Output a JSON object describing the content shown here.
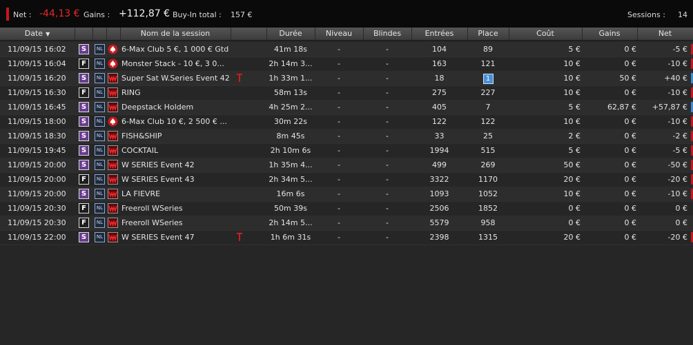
{
  "summary": {
    "net_label": "Net :",
    "net_value": "-44,13 €",
    "gains_label": "Gains :",
    "gains_value": "+112,87 €",
    "buyin_label": "Buy-In total :",
    "buyin_value": "157 €",
    "sessions_label": "Sessions :",
    "sessions_value": "14"
  },
  "columns": {
    "date": "Date",
    "name": "Nom de la session",
    "duree": "Durée",
    "niveau": "Niveau",
    "blindes": "Blindes",
    "entrees": "Entrées",
    "place": "Place",
    "cout": "Coût",
    "gains": "Gains",
    "net": "Net"
  },
  "rows": [
    {
      "date": "11/09/15 16:02",
      "type": "S",
      "limit": "NL",
      "room": "pokerstars",
      "name": "6-Max Club 5 €, 1 000 € Gtd",
      "ticket": false,
      "duree": "41m 18s",
      "niveau": "-",
      "blindes": "-",
      "entrees": "104",
      "place": "89",
      "place_win": false,
      "cout": "5 €",
      "gains": "0 €",
      "net": "-5 €",
      "result": "loss"
    },
    {
      "date": "11/09/15 16:04",
      "type": "F",
      "limit": "NL",
      "room": "pokerstars",
      "name": "Monster Stack - 10 €, 3 0...",
      "ticket": false,
      "duree": "2h 14m 3...",
      "niveau": "-",
      "blindes": "-",
      "entrees": "163",
      "place": "121",
      "place_win": false,
      "cout": "10 €",
      "gains": "0 €",
      "net": "-10 €",
      "result": "loss"
    },
    {
      "date": "11/09/15 16:20",
      "type": "S",
      "limit": "NL",
      "room": "winamax",
      "name": "Super Sat W.Series Event 42",
      "ticket": true,
      "duree": "1h 33m 1...",
      "niveau": "-",
      "blindes": "-",
      "entrees": "18",
      "place": "1",
      "place_win": true,
      "cout": "10 €",
      "gains": "50 €",
      "net": "+40 €",
      "result": "win"
    },
    {
      "date": "11/09/15 16:30",
      "type": "F",
      "limit": "NL",
      "room": "winamax",
      "name": "RING",
      "ticket": false,
      "duree": "58m 13s",
      "niveau": "-",
      "blindes": "-",
      "entrees": "275",
      "place": "227",
      "place_win": false,
      "cout": "10 €",
      "gains": "0 €",
      "net": "-10 €",
      "result": "loss"
    },
    {
      "date": "11/09/15 16:45",
      "type": "S",
      "limit": "NL",
      "room": "winamax",
      "name": "Deepstack Holdem",
      "ticket": false,
      "duree": "4h 25m 2...",
      "niveau": "-",
      "blindes": "-",
      "entrees": "405",
      "place": "7",
      "place_win": false,
      "cout": "5 €",
      "gains": "62,87 €",
      "net": "+57,87 €",
      "result": "win"
    },
    {
      "date": "11/09/15 18:00",
      "type": "S",
      "limit": "NL",
      "room": "pokerstars",
      "name": "6-Max Club 10 €, 2 500 € ...",
      "ticket": false,
      "duree": "30m 22s",
      "niveau": "-",
      "blindes": "-",
      "entrees": "122",
      "place": "122",
      "place_win": false,
      "cout": "10 €",
      "gains": "0 €",
      "net": "-10 €",
      "result": "loss"
    },
    {
      "date": "11/09/15 18:30",
      "type": "S",
      "limit": "NL",
      "room": "winamax",
      "name": "FISH&SHIP",
      "ticket": false,
      "duree": "8m 45s",
      "niveau": "-",
      "blindes": "-",
      "entrees": "33",
      "place": "25",
      "place_win": false,
      "cout": "2 €",
      "gains": "0 €",
      "net": "-2 €",
      "result": "loss"
    },
    {
      "date": "11/09/15 19:45",
      "type": "S",
      "limit": "NL",
      "room": "winamax",
      "name": "COCKTAIL",
      "ticket": false,
      "duree": "2h 10m 6s",
      "niveau": "-",
      "blindes": "-",
      "entrees": "1994",
      "place": "515",
      "place_win": false,
      "cout": "5 €",
      "gains": "0 €",
      "net": "-5 €",
      "result": "loss"
    },
    {
      "date": "11/09/15 20:00",
      "type": "S",
      "limit": "NL",
      "room": "winamax",
      "name": "W SERIES Event 42",
      "ticket": false,
      "duree": "1h 35m 4...",
      "niveau": "-",
      "blindes": "-",
      "entrees": "499",
      "place": "269",
      "place_win": false,
      "cout": "50 €",
      "gains": "0 €",
      "net": "-50 €",
      "result": "loss"
    },
    {
      "date": "11/09/15 20:00",
      "type": "F",
      "limit": "NL",
      "room": "winamax",
      "name": "W SERIES Event 43",
      "ticket": false,
      "duree": "2h 34m 5...",
      "niveau": "-",
      "blindes": "-",
      "entrees": "3322",
      "place": "1170",
      "place_win": false,
      "cout": "20 €",
      "gains": "0 €",
      "net": "-20 €",
      "result": "loss"
    },
    {
      "date": "11/09/15 20:00",
      "type": "S",
      "limit": "NL",
      "room": "winamax",
      "name": "LA FIEVRE",
      "ticket": false,
      "duree": "16m 6s",
      "niveau": "-",
      "blindes": "-",
      "entrees": "1093",
      "place": "1052",
      "place_win": false,
      "cout": "10 €",
      "gains": "0 €",
      "net": "-10 €",
      "result": "loss"
    },
    {
      "date": "11/09/15 20:30",
      "type": "F",
      "limit": "NL",
      "room": "winamax",
      "name": "Freeroll WSeries",
      "ticket": false,
      "duree": "50m 39s",
      "niveau": "-",
      "blindes": "-",
      "entrees": "2506",
      "place": "1852",
      "place_win": false,
      "cout": "0 €",
      "gains": "0 €",
      "net": "0 €",
      "result": "even"
    },
    {
      "date": "11/09/15 20:30",
      "type": "F",
      "limit": "NL",
      "room": "winamax",
      "name": "Freeroll WSeries",
      "ticket": false,
      "duree": "2h 14m 5...",
      "niveau": "-",
      "blindes": "-",
      "entrees": "5579",
      "place": "958",
      "place_win": false,
      "cout": "0 €",
      "gains": "0 €",
      "net": "0 €",
      "result": "even"
    },
    {
      "date": "11/09/15 22:00",
      "type": "S",
      "limit": "NL",
      "room": "winamax",
      "name": "W SERIES Event 47",
      "ticket": true,
      "duree": "1h 6m 31s",
      "niveau": "-",
      "blindes": "-",
      "entrees": "2398",
      "place": "1315",
      "place_win": false,
      "cout": "20 €",
      "gains": "0 €",
      "net": "-20 €",
      "result": "loss"
    }
  ],
  "colors": {
    "loss_bar": "#c8161d",
    "win_bar": "#3e8ad6",
    "type_s": "#6a3d8f",
    "neg_text": "#e8262c"
  },
  "icons": {
    "type_badge": "tournament-type-icon",
    "limit_badge": "no-limit-icon",
    "pokerstars": "pokerstars-spade-icon",
    "winamax": "winamax-logo-icon",
    "ticket": "ticket-icon"
  }
}
